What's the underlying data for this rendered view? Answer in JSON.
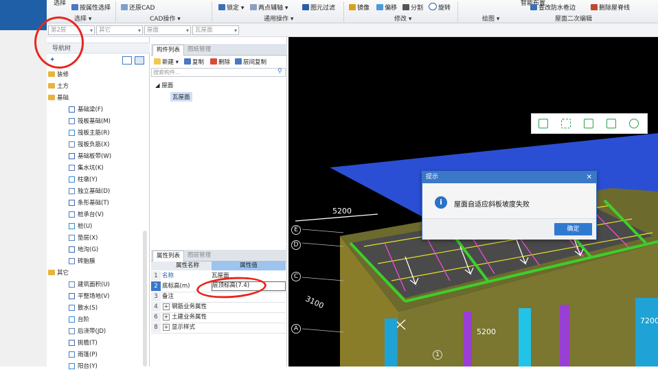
{
  "ribbon": {
    "items": {
      "select": "选择",
      "select_by_attr": "按属性选择",
      "restore_cad": "还原CAD",
      "lock": "锁定",
      "two_point_axis": "两点辅轴",
      "element_filter": "图元过滤",
      "mirror": "镜像",
      "offset": "偏移",
      "split": "分割",
      "rotate": "旋转",
      "smart_layout": "智能布置",
      "waterproof_edge": "查改防水卷边",
      "delete_ridge": "删除屋脊线"
    },
    "groups": {
      "select_group": "选择",
      "cad_ops": "CAD操作",
      "general_ops": "通用操作",
      "modify": "修改",
      "draw": "绘图",
      "roof_edit": "屋面二次编辑"
    }
  },
  "floorbar": {
    "floor": "第2层",
    "category": "其它",
    "type": "屋面",
    "element": "瓦屋面"
  },
  "nav": {
    "title": "导航树",
    "items": [
      {
        "label": "装修",
        "folder": true
      },
      {
        "label": "土方",
        "folder": true
      },
      {
        "label": "基础",
        "folder": true
      },
      {
        "label": "基础梁(F)",
        "folder": false
      },
      {
        "label": "筏板基础(M)",
        "folder": false
      },
      {
        "label": "筏板主筋(R)",
        "folder": false
      },
      {
        "label": "筏板负筋(X)",
        "folder": false
      },
      {
        "label": "基础板带(W)",
        "folder": false
      },
      {
        "label": "集水坑(K)",
        "folder": false
      },
      {
        "label": "柱墩(Y)",
        "folder": false
      },
      {
        "label": "独立基础(D)",
        "folder": false
      },
      {
        "label": "条形基础(T)",
        "folder": false
      },
      {
        "label": "桩承台(V)",
        "folder": false
      },
      {
        "label": "桩(U)",
        "folder": false
      },
      {
        "label": "垫层(X)",
        "folder": false
      },
      {
        "label": "地沟(G)",
        "folder": false
      },
      {
        "label": "砖胎膜",
        "folder": false
      },
      {
        "label": "其它",
        "folder": true
      },
      {
        "label": "建筑面积(U)",
        "folder": false
      },
      {
        "label": "平整场地(V)",
        "folder": false
      },
      {
        "label": "散水(S)",
        "folder": false
      },
      {
        "label": "台阶",
        "folder": false
      },
      {
        "label": "后浇带(JD)",
        "folder": false
      },
      {
        "label": "挑檐(T)",
        "folder": false
      },
      {
        "label": "雨篷(P)",
        "folder": false
      },
      {
        "label": "阳台(Y)",
        "folder": false
      }
    ]
  },
  "components": {
    "tab_active": "构件列表",
    "tab_inactive": "图纸管理",
    "new": "新建",
    "copy": "复制",
    "delete": "删除",
    "floor_copy": "层间复制",
    "search_placeholder": "搜索构件...",
    "tree_root": "屋面",
    "tree_child": "瓦屋面"
  },
  "properties": {
    "tab_active": "属性列表",
    "tab_inactive": "图层管理",
    "col_name": "属性名称",
    "col_value": "属性值",
    "rows": [
      {
        "n": "1",
        "name": "名称",
        "value": "瓦屋面"
      },
      {
        "n": "2",
        "name": "底标高(m)",
        "value": "层顶标高(7.4)"
      },
      {
        "n": "3",
        "name": "备注",
        "value": ""
      },
      {
        "n": "4",
        "name": "钢筋业务属性",
        "value": ""
      },
      {
        "n": "6",
        "name": "土建业务属性",
        "value": ""
      },
      {
        "n": "8",
        "name": "显示样式",
        "value": ""
      }
    ]
  },
  "viewport": {
    "dim_top": "5200",
    "dim_bottom": "5200",
    "dim_right": "7200",
    "dim_diag": "3100",
    "axes": [
      "E",
      "D",
      "C",
      "A",
      "1"
    ]
  },
  "dialog": {
    "title": "提示",
    "close": "✕",
    "info_glyph": "i",
    "message": "屋面自适应斜板坡度失败",
    "ok": "确定"
  },
  "colors": {
    "accent_blue": "#2f7ad1",
    "annotation_red": "#e8261f",
    "toolbar_green": "#27a04a"
  }
}
